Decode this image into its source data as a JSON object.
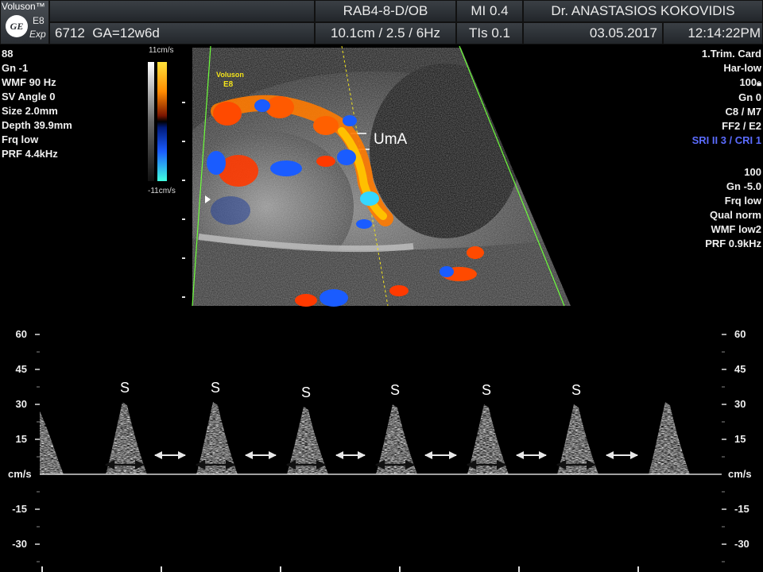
{
  "header": {
    "brand": "Voluson™",
    "logo": "GE",
    "model_line1": "E8",
    "model_line2": "Exp",
    "patient_id": "6712",
    "gestational_age": "GA=12w6d",
    "probe": "RAB4-8-D/OB",
    "depth_setting": "10.1cm / 2.5 / 6Hz",
    "mi": "MI  0.4",
    "tis": "TIs  0.1",
    "operator": "Dr. ANASTASIOS KOKOVIDIS",
    "date": "03.05.2017",
    "time": "12:14:22PM"
  },
  "left_params": [
    "88",
    "Gn  -1",
    "WMF 90 Hz",
    "SV Angle  0",
    "Size  2.0mm",
    "Depth 39.9mm",
    "Frq low",
    "PRF  4.4kHz"
  ],
  "right_params_a": [
    "1.Trim. Card",
    "Har-low",
    "100",
    "Gn   0",
    "C8 / M7",
    "FF2 / E2"
  ],
  "right_params_highlight": "SRI II 3 / CRI 1",
  "right_params_b": [
    "100",
    "Gn -5.0",
    "Frq low",
    "Qual norm",
    "WMF low2",
    "PRF  0.9kHz"
  ],
  "color_scale": {
    "top": "11cm/s",
    "bottom": "-11cm/s"
  },
  "image": {
    "annotation": "UmA",
    "watermark_line1": "Voluson",
    "watermark_line2": "E8"
  },
  "spectral": {
    "unit": "cm/s",
    "ticks": [
      60,
      45,
      30,
      15,
      -15,
      -30
    ],
    "tick_labels": [
      "60",
      "45",
      "30",
      "15",
      "-15",
      "-30"
    ],
    "peak_label": "S",
    "peak_count": 7,
    "colors": {
      "positive": "#ffb000",
      "negative": "#1a5cff",
      "marker": "#e8e8e8"
    }
  }
}
